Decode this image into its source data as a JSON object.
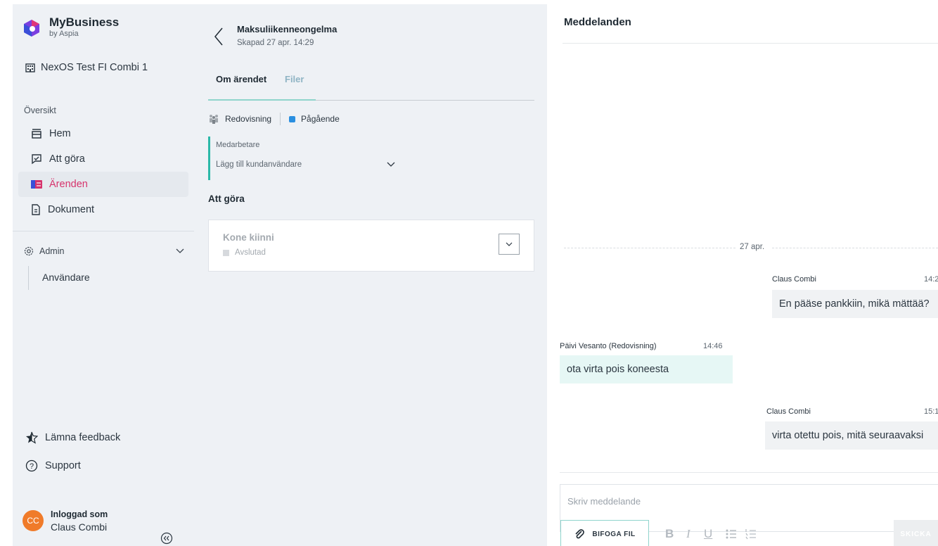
{
  "brand": {
    "title": "MyBusiness",
    "subtitle": "by Aspia"
  },
  "company": "NexOS Test FI Combi 1",
  "sidebar": {
    "section_label": "Översikt",
    "items": [
      {
        "label": "Hem",
        "icon": "home-icon"
      },
      {
        "label": "Att göra",
        "icon": "todo-icon"
      },
      {
        "label": "Ärenden",
        "icon": "cases-icon",
        "active": true
      },
      {
        "label": "Dokument",
        "icon": "document-icon"
      }
    ],
    "admin": {
      "label": "Admin",
      "sub_item": "Användare"
    },
    "feedback": "Lämna feedback",
    "support": "Support",
    "user": {
      "label": "Inloggad som",
      "name": "Claus Combi",
      "initials": "CC"
    }
  },
  "case": {
    "title": "Maksuliikenneongelma",
    "created": "Skapad 27 apr. 14:29",
    "tabs": [
      "Om ärendet",
      "Filer"
    ],
    "department": "Redovisning",
    "status": "Pågående",
    "collaborators_label": "Medarbetare",
    "add_customer_user": "Lägg till kundanvändare",
    "todo_heading": "Att göra",
    "tasks": [
      {
        "title": "Kone kiinni",
        "status": "Avslutad"
      }
    ]
  },
  "messages": {
    "title": "Meddelanden",
    "date_divider": "27 apr.",
    "items": [
      {
        "sender": "Claus Combi",
        "time": "14:2",
        "text": "En pääse pankkiin, mikä mättää?"
      },
      {
        "sender": "Päivi Vesanto (Redovisning)",
        "time": "14:46",
        "text": "ota virta pois koneesta"
      },
      {
        "sender": "Claus Combi",
        "time": "15:1",
        "text": "virta otettu pois, mitä seuraavaksi"
      }
    ],
    "compose_placeholder": "Skriv meddelande",
    "attach_label": "BIFOGA FIL",
    "send_label": "SKICKA",
    "format_buttons": [
      "B",
      "I",
      "U"
    ]
  },
  "colors": {
    "accent_pink": "#d6336c",
    "teal": "#2ab8a8",
    "status_blue": "#2a8fe0",
    "avatar_orange": "#f07b2a"
  }
}
